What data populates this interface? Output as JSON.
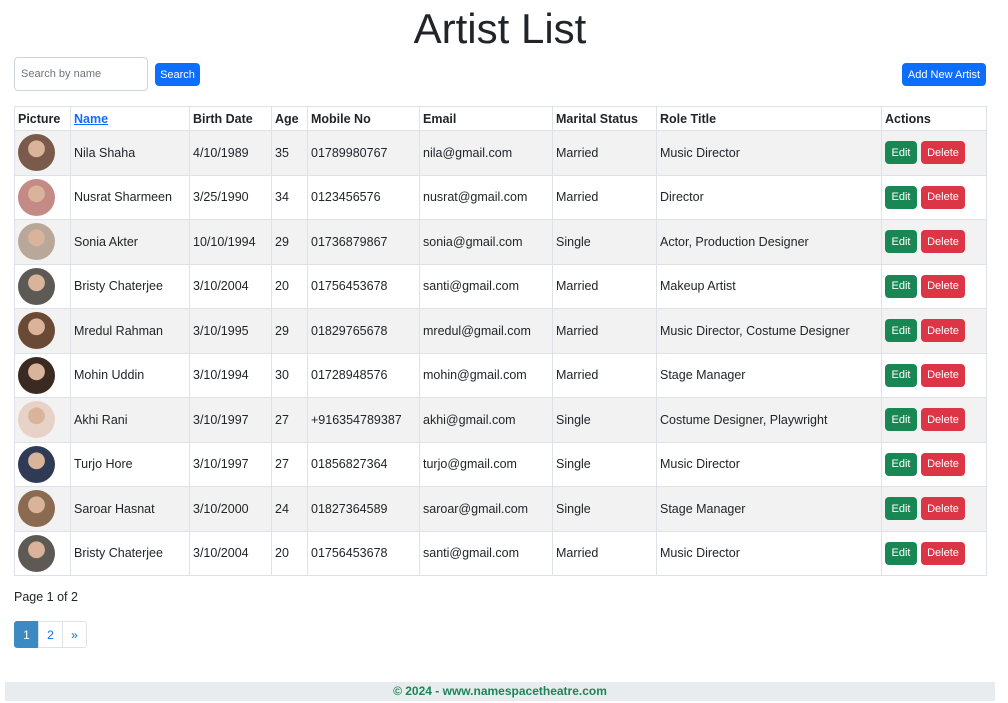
{
  "page": {
    "title": "Artist List"
  },
  "search": {
    "placeholder": "Search by name",
    "button_label": "Search"
  },
  "toolbar": {
    "add_label": "Add New Artist"
  },
  "table": {
    "headers": [
      "Picture",
      "Name",
      "Birth Date",
      "Age",
      "Mobile No",
      "Email",
      "Marital Status",
      "Role Title",
      "Actions"
    ],
    "edit_label": "Edit",
    "delete_label": "Delete",
    "rows": [
      {
        "name": "Nila Shaha",
        "birth": "4/10/1989",
        "age": "35",
        "mobile": "01789980767",
        "email": "nila@gmail.com",
        "marital": "Married",
        "role": "Music Director",
        "avatar_color": "#7a5a4a"
      },
      {
        "name": "Nusrat Sharmeen",
        "birth": "3/25/1990",
        "age": "34",
        "mobile": "0123456576",
        "email": "nusrat@gmail.com",
        "marital": "Married",
        "role": "Director",
        "avatar_color": "#c48a86"
      },
      {
        "name": "Sonia Akter",
        "birth": "10/10/1994",
        "age": "29",
        "mobile": "01736879867",
        "email": "sonia@gmail.com",
        "marital": "Single",
        "role": "Actor, Production Designer",
        "avatar_color": "#b9a79a"
      },
      {
        "name": "Bristy Chaterjee",
        "birth": "3/10/2004",
        "age": "20",
        "mobile": "01756453678",
        "email": "santi@gmail.com",
        "marital": "Married",
        "role": "Makeup Artist",
        "avatar_color": "#5d5a55"
      },
      {
        "name": "Mredul Rahman",
        "birth": "3/10/1995",
        "age": "29",
        "mobile": "01829765678",
        "email": "mredul@gmail.com",
        "marital": "Married",
        "role": "Music Director, Costume Designer",
        "avatar_color": "#6b4a35"
      },
      {
        "name": "Mohin Uddin",
        "birth": "3/10/1994",
        "age": "30",
        "mobile": "01728948576",
        "email": "mohin@gmail.com",
        "marital": "Married",
        "role": "Stage Manager",
        "avatar_color": "#3b2a22"
      },
      {
        "name": "Akhi Rani",
        "birth": "3/10/1997",
        "age": "27",
        "mobile": "+916354789387",
        "email": "akhi@gmail.com",
        "marital": "Single",
        "role": "Costume Designer, Playwright",
        "avatar_color": "#e8d2c8"
      },
      {
        "name": "Turjo Hore",
        "birth": "3/10/1997",
        "age": "27",
        "mobile": "01856827364",
        "email": "turjo@gmail.com",
        "marital": "Single",
        "role": "Music Director",
        "avatar_color": "#2f3a55"
      },
      {
        "name": "Saroar Hasnat",
        "birth": "3/10/2000",
        "age": "24",
        "mobile": "01827364589",
        "email": "saroar@gmail.com",
        "marital": "Single",
        "role": "Stage Manager",
        "avatar_color": "#8a6a50"
      },
      {
        "name": "Bristy Chaterjee",
        "birth": "3/10/2004",
        "age": "20",
        "mobile": "01756453678",
        "email": "santi@gmail.com",
        "marital": "Married",
        "role": "Music Director",
        "avatar_color": "#5d5a55"
      }
    ]
  },
  "pagination": {
    "info": "Page 1 of 2",
    "pages": [
      "1",
      "2"
    ],
    "next": "»"
  },
  "footer": {
    "text": "© 2024 - www.namespacetheatre.com"
  },
  "colors": {
    "primary": "#0d6efd",
    "success": "#198754",
    "danger": "#dc3545",
    "active_page": "#3b8ac4"
  }
}
